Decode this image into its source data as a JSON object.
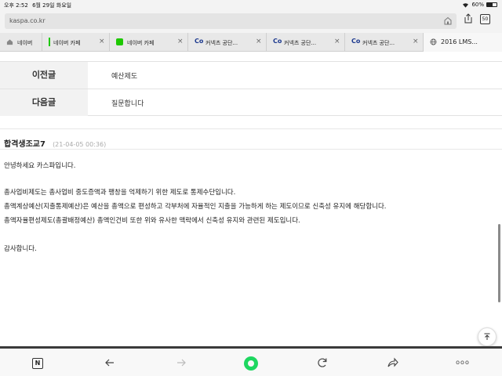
{
  "status_bar": {
    "time": "오후 2:52",
    "date": "6월 29일 화요일",
    "battery": "60%",
    "battery_level": 0.6
  },
  "browser": {
    "url": "kaspa.co.kr",
    "tab_count": "50"
  },
  "tabs": [
    {
      "label": "네이버",
      "icon": "home-icon"
    },
    {
      "label": "네이버 카페",
      "icon": "naver-cafe-bar-icon"
    },
    {
      "label": "네이버 카페",
      "icon": "naver-cafe-icon"
    },
    {
      "label": "커넥츠 공단...",
      "icon": "connects-co-icon"
    },
    {
      "label": "커넥츠 공단...",
      "icon": "connects-co-icon"
    },
    {
      "label": "커넥츠 공단...",
      "icon": "connects-co-icon"
    },
    {
      "label": "2016 LMS...",
      "icon": "globe-icon"
    }
  ],
  "nav": {
    "prev_label": "이전글",
    "prev_title": "예산제도",
    "next_label": "다음글",
    "next_title": "질문합니다"
  },
  "comment": {
    "author": "합격생조교7",
    "date": "(21-04-05 00:36)",
    "lines": [
      "안녕하세요 카스파입니다.",
      "총사업비제도는 총사업비 중도증액과 팽창을 억제하기 위한 제도로 통제수단입니다.",
      "총액계상예산(지출통제예산)은 예산을 총액으로 편성하고 각부처에 자율적인 지출을 가능하게 하는 제도이므로 신축성 유지에 해당합니다.",
      "총액자율편성제도(총괄배정예산) 총액인건비 또한 위와  유사한 맥락에서 신축성 유지와 관련된 제도입니다.",
      "감사합니다."
    ]
  },
  "toolbar": {
    "n_label": "N",
    "more_label": "ooo"
  },
  "colors": {
    "naver_green": "#1ec800",
    "toolbar_green": "#1ed760"
  }
}
